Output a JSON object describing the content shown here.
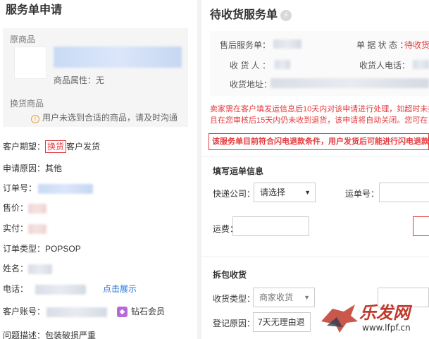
{
  "left": {
    "title": "服务单申请",
    "original_goods_label": "原商品",
    "goods_attr_label": "商品属性：",
    "goods_attr_value": "无",
    "exchange_goods_label": "换货商品",
    "warning_text": "用户未选到合适的商品，请及时沟通",
    "expect_label": "客户期望：",
    "expect_tag": "换货",
    "expect_value": "客户发货",
    "reason_label": "申请原因：",
    "reason_value": "其他",
    "order_no_label": "订单号：",
    "price_label": "售价：",
    "paid_label": "实付：",
    "order_type_label": "订单类型：",
    "order_type_value": "POPSOP",
    "name_label": "姓名：",
    "phone_label": "电话：",
    "phone_link": "点击展示",
    "account_label": "客户账号：",
    "member_level": "钻石会员",
    "issue_label": "问题描述：",
    "issue_value": "包装破损严重"
  },
  "right": {
    "title": "待收货服务单",
    "service_no_label": "售后服务单：",
    "status_label": "单 据 状 态 ：",
    "status_value": "待收货",
    "receiver_label": "收 货 人 ：",
    "receiver_phone_label": "收货人电话：",
    "address_label": "收货地址：",
    "notice_line1": "卖家需在客户填发运信息后10天内对该申请进行处理，如超时未操",
    "notice_line2": "且在您审核后15天内仍未收到退货，该申请将自动关闭。您可在",
    "alert_text": "该服务单目前符合闪电退款条件，用户发货后可能进行闪电退款",
    "waybill_section": "填写运单信息",
    "courier_label": "快递公司：",
    "courier_value": "请选择",
    "waybill_label": "运单号：",
    "freight_label": "运费：",
    "unpack_section": "拆包收货",
    "receive_type_label": "收货类型：",
    "receive_type_value": "商家收货",
    "register_reason_label": "登记原因：",
    "register_reason_value": "7天无理由退"
  },
  "watermark": {
    "text": "乐发网",
    "url": "www.lfpf.cn"
  },
  "colors": {
    "accent_red": "#e4393c",
    "link_blue": "#1e6fd9",
    "panel_gray": "#f5f5f5"
  }
}
